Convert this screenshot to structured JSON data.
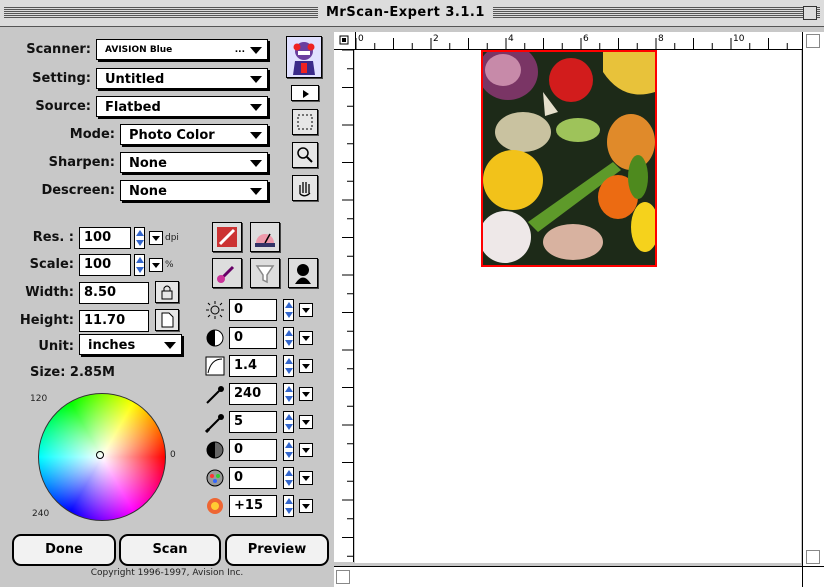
{
  "window": {
    "title": "MrScan-Expert 3.1.1"
  },
  "scanner": {
    "label": "Scanner:",
    "value": "AVISION Blue",
    "ellipsis": "..."
  },
  "setting": {
    "label": "Setting:",
    "value": "Untitled"
  },
  "source": {
    "label": "Source:",
    "value": "Flatbed"
  },
  "mode": {
    "label": "Mode:",
    "value": "Photo Color"
  },
  "sharpen": {
    "label": "Sharpen:",
    "value": "None"
  },
  "descreen": {
    "label": "Descreen:",
    "value": "None"
  },
  "res": {
    "label": "Res. :",
    "value": "100",
    "unit": "dpi"
  },
  "scale": {
    "label": "Scale:",
    "value": "100",
    "unit": "%"
  },
  "width": {
    "label": "Width:",
    "value": "8.50"
  },
  "height": {
    "label": "Height:",
    "value": "11.70"
  },
  "unit": {
    "label": "Unit:",
    "value": "inches"
  },
  "size": {
    "label": "Size: 2.85M"
  },
  "colorwheel": {
    "label_120": "120",
    "label_0": "0",
    "label_240": "240"
  },
  "adjust": [
    {
      "icon": "brightness-icon",
      "value": "0"
    },
    {
      "icon": "contrast-icon",
      "value": "0"
    },
    {
      "icon": "gamma-icon",
      "value": "1.4"
    },
    {
      "icon": "highlight-eyedropper-icon",
      "value": "240"
    },
    {
      "icon": "shadow-eyedropper-icon",
      "value": "5"
    },
    {
      "icon": "midtone-icon",
      "value": "0"
    },
    {
      "icon": "color-balance-icon",
      "value": "0"
    },
    {
      "icon": "saturation-icon",
      "value": "+15"
    }
  ],
  "buttons": {
    "done": "Done",
    "scan": "Scan",
    "preview": "Preview"
  },
  "copyright": "Copyright 1996-1997, Avision Inc.",
  "ruler": {
    "marks": [
      "0",
      "2",
      "4",
      "6",
      "8",
      "10"
    ]
  },
  "colors": {
    "panel": "#c8c8c8",
    "selection": "#ff0000",
    "stepper": "#3366cc"
  }
}
